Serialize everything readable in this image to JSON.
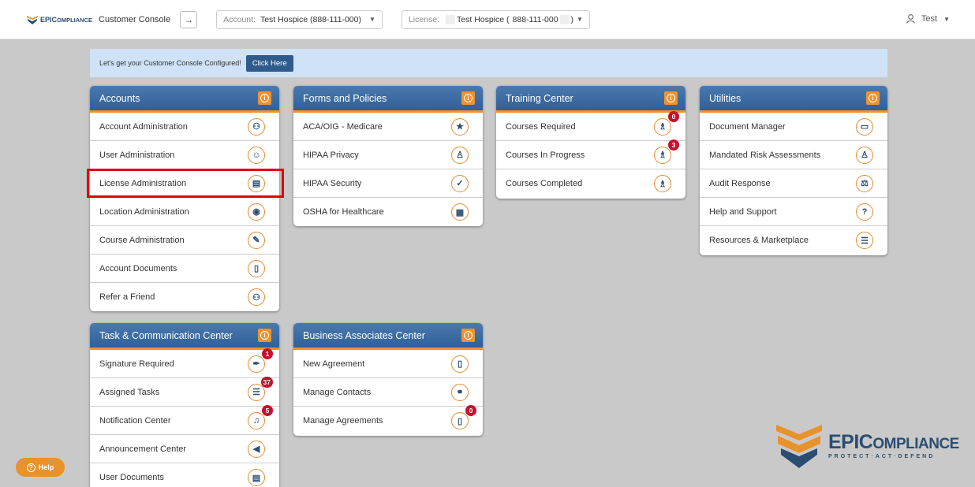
{
  "topbar": {
    "logo_text_big": "EPIC",
    "logo_text_small": "OMPLIANCE",
    "console_title": "Customer Console",
    "nav_arrow": "→",
    "account_label": "Account:",
    "account_value": "Test Hospice (888-111-000)",
    "license_label": "License:",
    "license_value_pre": "Test Hospice (",
    "license_value_num": "888-111-000",
    "license_value_post": ")",
    "user_name": "Test"
  },
  "banner": {
    "text": "Let's get your Customer Console Configured!",
    "button_label": "Click Here"
  },
  "panels": {
    "accounts": {
      "title": "Accounts",
      "items": [
        {
          "label": "Account Administration",
          "icon": "account-admin-icon",
          "glyph": "⚇"
        },
        {
          "label": "User Administration",
          "icon": "user-icon",
          "glyph": "☺"
        },
        {
          "label": "License Administration",
          "icon": "id-card-icon",
          "glyph": "▤"
        },
        {
          "label": "Location Administration",
          "icon": "location-pin-icon",
          "glyph": "◉"
        },
        {
          "label": "Course Administration",
          "icon": "graduate-icon",
          "glyph": "✎"
        },
        {
          "label": "Account Documents",
          "icon": "document-icon",
          "glyph": "▯"
        },
        {
          "label": "Refer a Friend",
          "icon": "users-icon",
          "glyph": "⚇"
        }
      ]
    },
    "forms": {
      "title": "Forms and Policies",
      "items": [
        {
          "label": "ACA/OIG - Medicare",
          "icon": "star-icon",
          "glyph": "★"
        },
        {
          "label": "HIPAA Privacy",
          "icon": "user-secret-icon",
          "glyph": "♙"
        },
        {
          "label": "HIPAA Security",
          "icon": "shield-check-icon",
          "glyph": "✓"
        },
        {
          "label": "OSHA for Healthcare",
          "icon": "clipboard-icon",
          "glyph": "▦"
        }
      ]
    },
    "training": {
      "title": "Training Center",
      "items": [
        {
          "label": "Courses Required",
          "icon": "teacher-icon",
          "glyph": "♗",
          "badge": "0"
        },
        {
          "label": "Courses In Progress",
          "icon": "teacher-icon",
          "glyph": "♗",
          "badge": "3"
        },
        {
          "label": "Courses Completed",
          "icon": "teacher-icon",
          "glyph": "♗"
        }
      ]
    },
    "utilities": {
      "title": "Utilities",
      "items": [
        {
          "label": "Document Manager",
          "icon": "folder-open-icon",
          "glyph": "▭"
        },
        {
          "label": "Mandated Risk Assessments",
          "icon": "user-tie-icon",
          "glyph": "♙"
        },
        {
          "label": "Audit Response",
          "icon": "scale-icon",
          "glyph": "⚖"
        },
        {
          "label": "Help and Support",
          "icon": "question-icon",
          "glyph": "?"
        },
        {
          "label": "Resources & Marketplace",
          "icon": "store-icon",
          "glyph": "☰"
        }
      ]
    },
    "tasks": {
      "title": "Task & Communication Center",
      "items": [
        {
          "label": "Signature Required",
          "icon": "pen-icon",
          "glyph": "✒",
          "badge": "1"
        },
        {
          "label": "Assigned Tasks",
          "icon": "tasks-icon",
          "glyph": "☰",
          "badge": "37"
        },
        {
          "label": "Notification Center",
          "icon": "bell-icon",
          "glyph": "♫",
          "badge": "5"
        },
        {
          "label": "Announcement Center",
          "icon": "megaphone-icon",
          "glyph": "◀"
        },
        {
          "label": "User Documents",
          "icon": "file-icon",
          "glyph": "▤"
        }
      ]
    },
    "business": {
      "title": "Business Associates Center",
      "items": [
        {
          "label": "New Agreement",
          "icon": "file-signature-icon",
          "glyph": "▯"
        },
        {
          "label": "Manage Contacts",
          "icon": "handshake-icon",
          "glyph": "⚭"
        },
        {
          "label": "Manage Agreements",
          "icon": "file-signature-icon",
          "glyph": "▯",
          "badge": "0"
        }
      ]
    }
  },
  "info_glyph": "i",
  "help_button": "Help",
  "help_glyph": "?",
  "brand": {
    "name_big": "EPIC",
    "name_small": "OMPLIANCE",
    "tagline": "PROTECT·ACT·DEFEND"
  },
  "colors": {
    "header_blue": "#30609a",
    "accent_orange": "#f0922d",
    "badge_red": "#c8102e",
    "highlight_red": "#e00000"
  }
}
